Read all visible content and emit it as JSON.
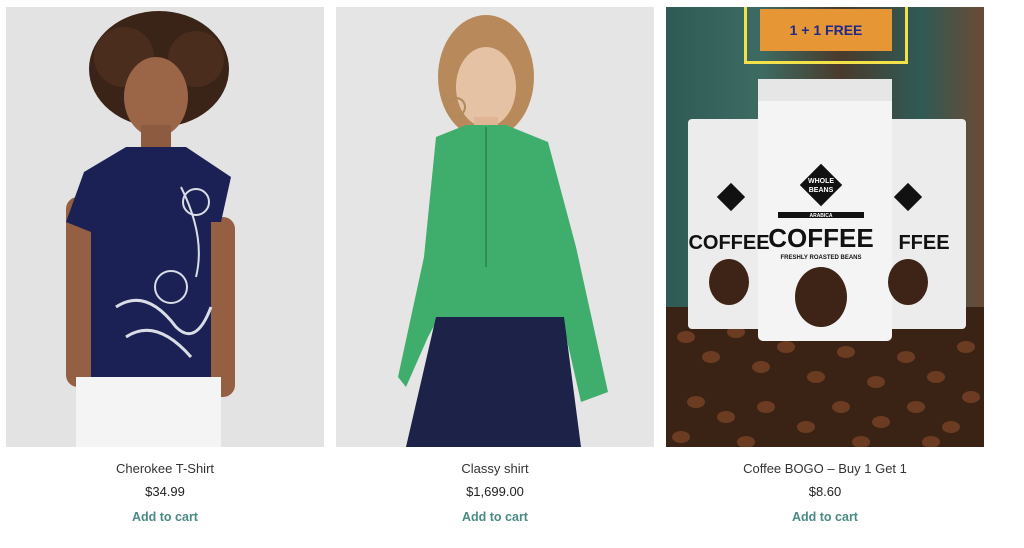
{
  "products": [
    {
      "title": "Cherokee T-Shirt",
      "price": "$34.99",
      "cta": "Add to cart"
    },
    {
      "title": "Classy shirt",
      "price": "$1,699.00",
      "cta": "Add to cart"
    },
    {
      "title": "Coffee BOGO – Buy 1 Get 1",
      "price": "$8.60",
      "cta": "Add to cart",
      "badge": "1 + 1 FREE",
      "bag": {
        "logo_line1": "WHOLE",
        "logo_line2": "BEANS",
        "small": "ARABICA",
        "main": "COFFEE",
        "sub": "FRESHLY ROASTED BEANS"
      }
    }
  ],
  "colors": {
    "cta": "#4a8a84",
    "badge_bg": "#e79636",
    "badge_border": "#f3e14a",
    "badge_text": "#1e2a8a"
  }
}
